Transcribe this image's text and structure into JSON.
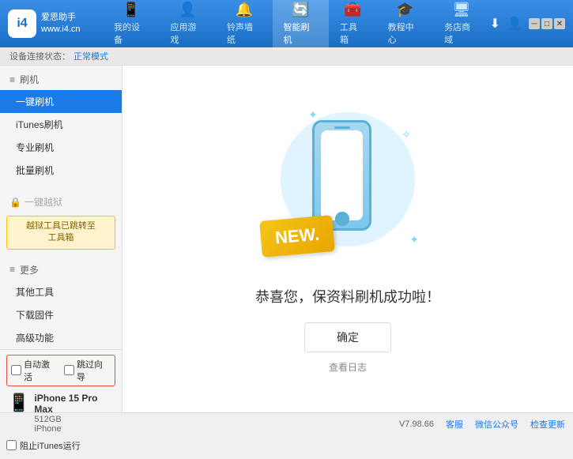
{
  "app": {
    "logo_text_line1": "爱思助手",
    "logo_text_line2": "www.i4.cn",
    "logo_letter": "i4"
  },
  "nav": {
    "tabs": [
      {
        "id": "my-device",
        "icon": "📱",
        "label": "我的设备"
      },
      {
        "id": "apps-games",
        "icon": "👤",
        "label": "应用游戏"
      },
      {
        "id": "ringtones",
        "icon": "🔔",
        "label": "铃声墙纸"
      },
      {
        "id": "smart-flash",
        "icon": "🔄",
        "label": "智能刷机",
        "active": true
      },
      {
        "id": "toolbox",
        "icon": "🧰",
        "label": "工具箱"
      },
      {
        "id": "tutorials",
        "icon": "🎓",
        "label": "教程中心"
      },
      {
        "id": "service",
        "icon": "🖥",
        "label": "务店商域"
      }
    ]
  },
  "breadcrumb": {
    "label": "设备连接状态：",
    "status": "正常模式"
  },
  "sidebar": {
    "section_flash": "刷机",
    "items": [
      {
        "id": "one-key-flash",
        "label": "一键刷机",
        "active": true
      },
      {
        "id": "itunes-flash",
        "label": "iTunes刷机"
      },
      {
        "id": "pro-flash",
        "label": "专业刷机"
      },
      {
        "id": "batch-flash",
        "label": "批量刷机"
      }
    ],
    "section_onekey_status": "一键越狱",
    "warning_text": "越狱工具已跳转至\n工具箱",
    "section_more": "更多",
    "more_items": [
      {
        "id": "other-tools",
        "label": "其他工具"
      },
      {
        "id": "download-firmware",
        "label": "下载固件"
      },
      {
        "id": "advanced",
        "label": "高级功能"
      }
    ]
  },
  "device_panel": {
    "auto_activate_label": "自动激活",
    "guided_setup_label": "跳过向导",
    "device_name": "iPhone 15 Pro Max",
    "storage": "512GB",
    "type": "iPhone",
    "itunes_label": "阻止iTunes运行"
  },
  "content": {
    "new_badge": "NEW.",
    "success_text": "恭喜您，保资料刷机成功啦！",
    "confirm_button": "确定",
    "view_log": "查看日志"
  },
  "statusbar": {
    "version_label": "V7.98.66",
    "links": [
      {
        "id": "home",
        "label": "客服"
      },
      {
        "id": "wechat",
        "label": "微信公众号"
      },
      {
        "id": "check-update",
        "label": "检查更新"
      }
    ]
  },
  "icons": {
    "download": "⬇",
    "user": "👤",
    "phone": "📱",
    "lock": "🔒",
    "check": "☑",
    "uncheck": "☐"
  }
}
